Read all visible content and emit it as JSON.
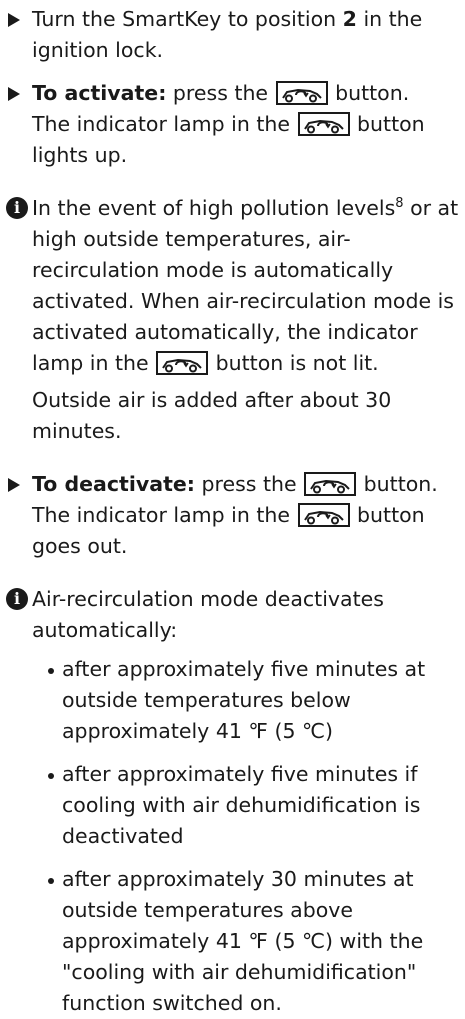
{
  "step1": {
    "before": "Turn the SmartKey to position ",
    "position": "2",
    "after": " in the ignition lock."
  },
  "step2": {
    "label": "To activate:",
    "line1_before": " press the ",
    "line1_after": " button.",
    "line2_before": "The indicator lamp in the ",
    "line2_after": " button lights up."
  },
  "note1": {
    "text_a": "In the event of high pollution levels",
    "footnote": "8",
    "text_b": " or at high outside temperatures, air-recirculation mode is automatically activated. When air-recirculation mode is activated automatically, the indicator lamp in the ",
    "text_c": " button is not lit.",
    "para2": "Outside air is added after about 30 minutes."
  },
  "step3": {
    "label": "To deactivate:",
    "line1_before": " press the ",
    "line1_after": " button.",
    "line2_before": "The indicator lamp in the ",
    "line2_after": " button goes out."
  },
  "note2": {
    "intro": "Air-recirculation mode deactivates automatically:",
    "bullets": [
      "after approximately five minutes at outside temperatures below approximately 41 ℉ (5 ℃)",
      "after approximately five minutes if cooling with air dehumidification is deactivated",
      "after approximately 30 minutes at outside temperatures above approximately 41 ℉ (5 ℃) with the \"cooling with air dehumidification\" function switched on."
    ]
  },
  "icons": {
    "info": "info-icon",
    "step": "arrow-right-icon",
    "button": "air-recirculation-button-icon"
  }
}
